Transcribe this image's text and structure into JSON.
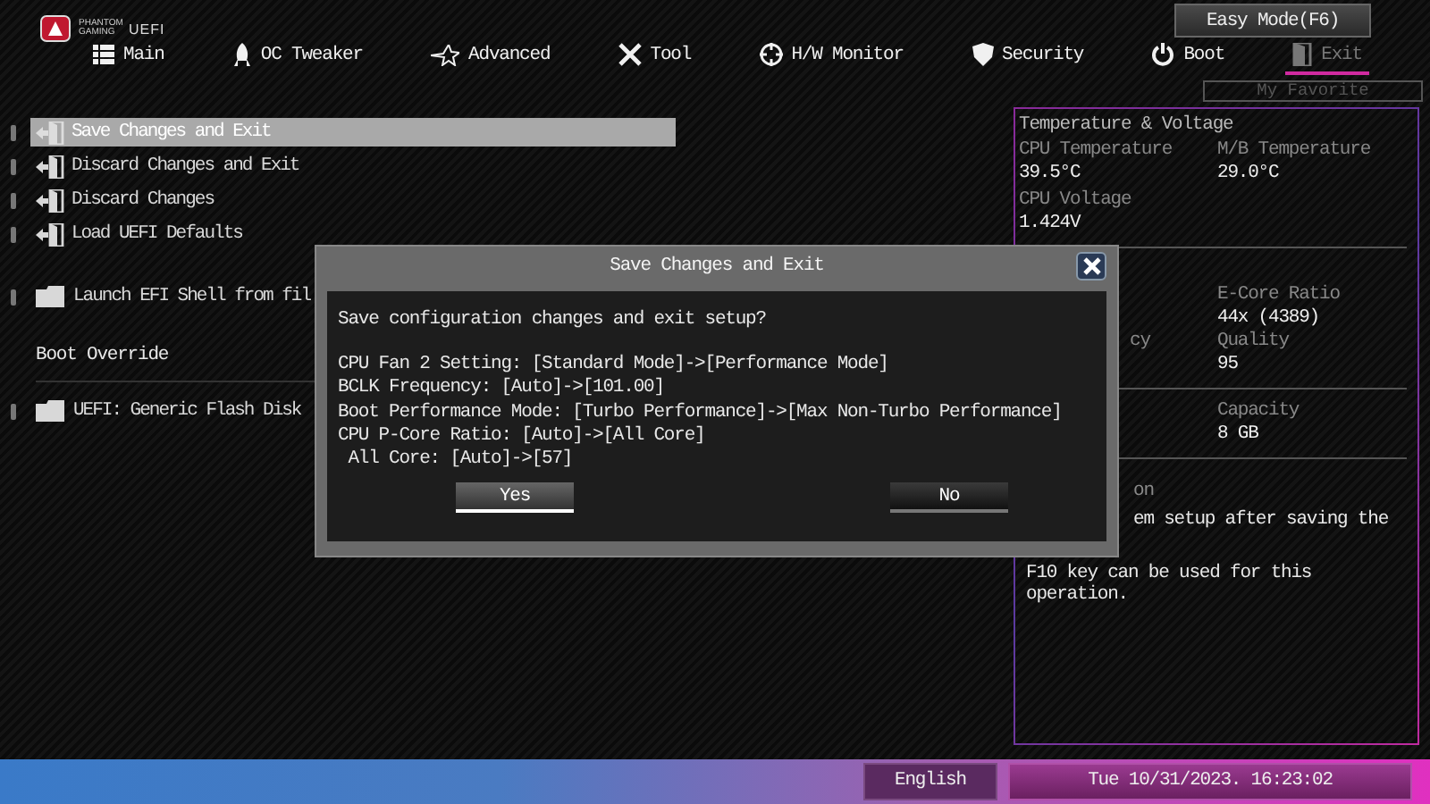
{
  "header": {
    "brand": "PHANTOM GAMING",
    "product": "UEFI",
    "easy_mode_button": "Easy Mode(F6)",
    "my_favorite": "My Favorite"
  },
  "tabs": [
    {
      "label": "Main",
      "selected": false
    },
    {
      "label": "OC Tweaker",
      "selected": false
    },
    {
      "label": "Advanced",
      "selected": false
    },
    {
      "label": "Tool",
      "selected": false
    },
    {
      "label": "H/W Monitor",
      "selected": false
    },
    {
      "label": "Security",
      "selected": false
    },
    {
      "label": "Boot",
      "selected": false
    },
    {
      "label": "Exit",
      "selected": true
    }
  ],
  "menu": [
    {
      "kind": "exit",
      "label": "Save Changes and Exit",
      "selected": true
    },
    {
      "kind": "exit",
      "label": "Discard Changes and Exit",
      "selected": false
    },
    {
      "kind": "exit",
      "label": "Discard Changes",
      "selected": false
    },
    {
      "kind": "exit",
      "label": "Load UEFI Defaults",
      "selected": false
    },
    {
      "kind": "folder",
      "label": "Launch EFI Shell from fil",
      "selected": false
    },
    {
      "kind": "section",
      "label": "Boot Override"
    },
    {
      "kind": "folder",
      "label": "UEFI: Generic Flash Disk",
      "selected": false
    }
  ],
  "panel": {
    "title": "Temperature & Voltage",
    "readings": [
      {
        "label": "CPU Temperature",
        "value": "39.5°C"
      },
      {
        "label": "M/B Temperature",
        "value": "29.0°C"
      },
      {
        "label": "CPU Voltage",
        "value": "1.424V"
      }
    ],
    "cpu_fragments": [
      {
        "label": "cy"
      }
    ],
    "cpu": [
      {
        "label": "E-Core Ratio",
        "value": "44x (4389)"
      },
      {
        "label": "Quality",
        "value": "95"
      }
    ],
    "memory": [
      {
        "label": "Capacity",
        "value": "8 GB"
      }
    ],
    "description_fragments": [
      "on",
      "em setup after saving the"
    ],
    "description_note": "F10 key can be used for this operation."
  },
  "dialog": {
    "title": "Save Changes and Exit",
    "question": "Save configuration changes and exit setup?",
    "changes": [
      "CPU Fan 2 Setting: [Standard Mode]->[Performance Mode]",
      "BCLK Frequency: [Auto]->[101.00]",
      "Boot Performance Mode: [Turbo Performance]->[Max Non-Turbo Performance]",
      "CPU P-Core Ratio: [Auto]->[All Core]",
      " All Core: [Auto]->[57]"
    ],
    "buttons": [
      {
        "label": "Yes",
        "selected": true
      },
      {
        "label": "No",
        "selected": false
      }
    ]
  },
  "status_bar": {
    "language": "English",
    "datetime": "Tue 10/31/2023. 16:23:02"
  }
}
